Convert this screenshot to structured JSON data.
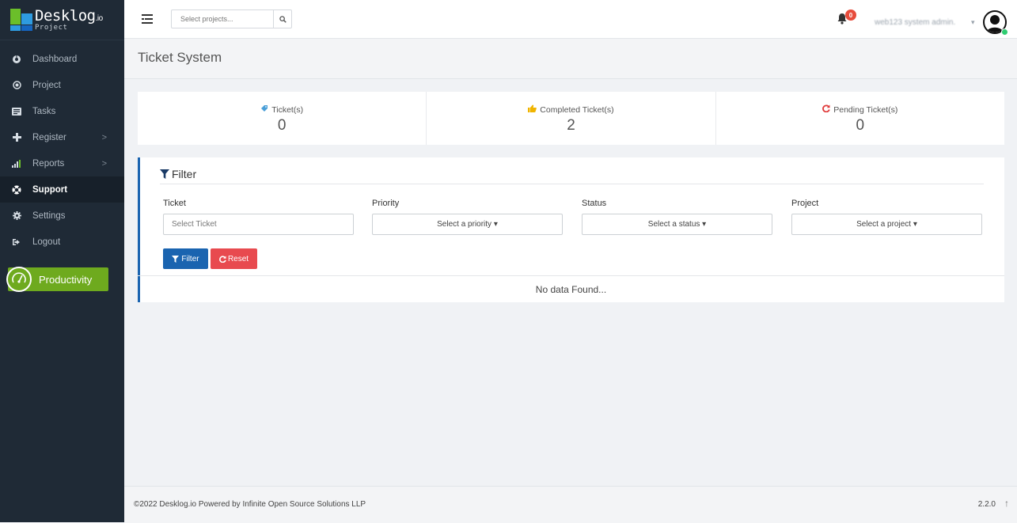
{
  "brand": {
    "name": "Desklog",
    "tld": ".io",
    "sub": "Project"
  },
  "sidebar": {
    "items": [
      {
        "label": "Dashboard",
        "icon": "dashboard-icon"
      },
      {
        "label": "Project",
        "icon": "project-icon"
      },
      {
        "label": "Tasks",
        "icon": "tasks-icon"
      },
      {
        "label": "Register",
        "icon": "plus-icon",
        "chevron": ">"
      },
      {
        "label": "Reports",
        "icon": "bar-chart-icon",
        "chevron": ">"
      },
      {
        "label": "Support",
        "icon": "support-icon",
        "active": true
      },
      {
        "label": "Settings",
        "icon": "gear-icon"
      },
      {
        "label": "Logout",
        "icon": "logout-icon"
      }
    ],
    "productivity_label": "Productivity"
  },
  "topbar": {
    "search_placeholder": "Select projects...",
    "notification_count": "0",
    "user_name": "web123 system admin.",
    "user_caret": "▾"
  },
  "page": {
    "title": "Ticket System"
  },
  "stats": [
    {
      "label": "Ticket(s)",
      "value": "0",
      "icon": "tag-icon",
      "color": "#4a9fd8"
    },
    {
      "label": "Completed Ticket(s)",
      "value": "2",
      "icon": "thumbs-up-icon",
      "color": "#f0b400"
    },
    {
      "label": "Pending Ticket(s)",
      "value": "0",
      "icon": "refresh-icon",
      "color": "#e03b3b"
    }
  ],
  "filter": {
    "title": "Filter",
    "ticket": {
      "label": "Ticket",
      "placeholder": "Select Ticket"
    },
    "priority": {
      "label": "Priority",
      "value": "Select a priority ▾"
    },
    "status": {
      "label": "Status",
      "value": "Select a status ▾"
    },
    "project": {
      "label": "Project",
      "value": "Select a project ▾"
    },
    "filter_button": "Filter",
    "reset_button": "Reset",
    "empty_message": "No data Found..."
  },
  "footer": {
    "copyright": "©2022 Desklog.io Powered by Infinite Open Source Solutions LLP",
    "version": "2.2.0",
    "to_top": "↑"
  },
  "colors": {
    "sidebar_bg": "#1f2a36",
    "primary": "#1a64b0",
    "danger": "#e84a4f",
    "productivity": "#6eaa1e",
    "badge": "#e74c3c"
  }
}
